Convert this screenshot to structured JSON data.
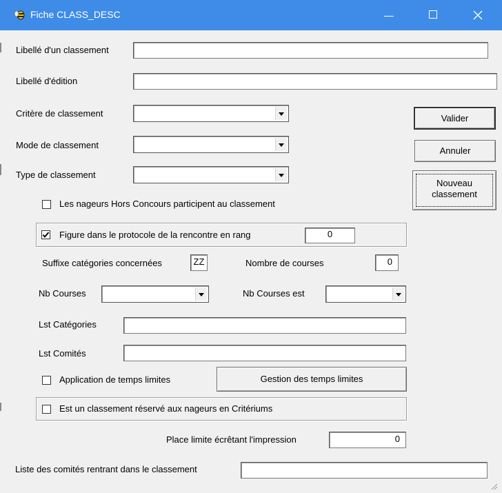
{
  "window": {
    "title": "Fiche CLASS_DESC",
    "app_icon": "bee-icon",
    "controls": [
      "minimize-icon",
      "maximize-icon",
      "close-icon"
    ]
  },
  "form": {
    "libelle_classement": {
      "label": "Libellé d'un classement",
      "value": ""
    },
    "libelle_edition": {
      "label": "Libellé d'édition",
      "value": ""
    },
    "critere": {
      "label": "Critère de classement",
      "value": ""
    },
    "mode": {
      "label": "Mode de classement",
      "value": ""
    },
    "type": {
      "label": "Type de classement",
      "value": ""
    },
    "hors_concours": {
      "label": "Les nageurs Hors Concours participent au classement",
      "checked": false
    },
    "protocole": {
      "label": "Figure dans le protocole de la rencontre  en rang",
      "checked": true,
      "rang": "0"
    },
    "suffixe": {
      "label": "Suffixe catégories concernées",
      "value": "ZZ"
    },
    "nombre_courses": {
      "label": "Nombre de courses",
      "value": "0"
    },
    "nb_courses": {
      "label": "Nb Courses",
      "value": ""
    },
    "nb_courses_est": {
      "label": "Nb Courses est",
      "value": ""
    },
    "lst_categories": {
      "label": "Lst Catégories",
      "value": ""
    },
    "lst_comites": {
      "label": "Lst Comités",
      "value": ""
    },
    "temps_limites": {
      "label": "Application de temps limites",
      "checked": false
    },
    "gestion_temps_limites": "Gestion des temps limites",
    "criteriums": {
      "label": "Est un classement réservé aux nageurs en Critériums",
      "checked": false
    },
    "place_limite": {
      "label": "Place limite écrêtant l'impression",
      "value": "0"
    },
    "liste_comites": {
      "label": "Liste des comités rentrant dans le classement",
      "value": ""
    }
  },
  "buttons": {
    "valider": "Valider",
    "annuler": "Annuler",
    "nouveau_line1": "Nouveau",
    "nouveau_line2": "classement"
  }
}
